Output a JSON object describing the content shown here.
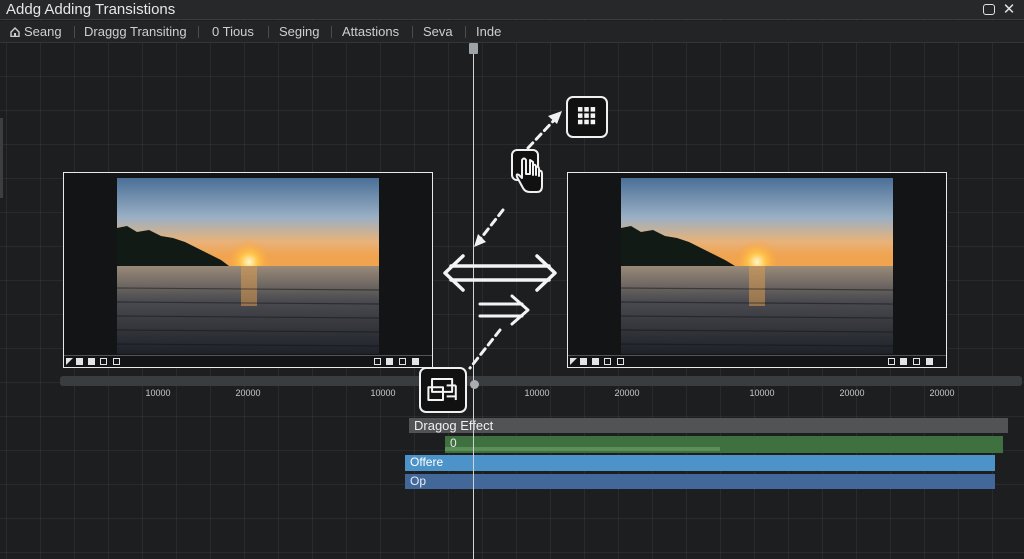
{
  "window": {
    "title": "Addg Adding Transistions",
    "restore_icon": "restore-icon",
    "close_icon": "close-icon",
    "close_glyph": "✕"
  },
  "menu": {
    "items": [
      {
        "label": "Seang",
        "icon": "home-icon"
      },
      {
        "label": "Draggg Transiting"
      },
      {
        "label": "0 Tious"
      },
      {
        "label": "Seging"
      },
      {
        "label": "Attastions"
      },
      {
        "label": "Seva"
      },
      {
        "label": "Inde"
      }
    ]
  },
  "viewers": [
    {
      "name": "source-clip",
      "thumbnail": "sunset over lake"
    },
    {
      "name": "target-clip",
      "thumbnail": "sunset over lake"
    }
  ],
  "ruler": {
    "ticks": [
      "10000",
      "20000",
      "10000",
      "10000",
      "20000",
      "10000",
      "20000",
      "20000"
    ]
  },
  "tracks": {
    "drag_effect": "Dragog Effect",
    "green": "0",
    "offere": "Offere",
    "op": "Op"
  },
  "icons": {
    "grid": "grid-icon",
    "hand": "hand-pointer-icon",
    "effect": "effect-icon",
    "transition_arrows": "double-arrow-icon",
    "right_arrows": "right-double-arrow-icon"
  },
  "colors": {
    "background": "#1c1e20",
    "track_gray": "#515355",
    "track_green": "#3e7040",
    "track_blue": "#4b93c8",
    "track_navy": "#42689a"
  }
}
